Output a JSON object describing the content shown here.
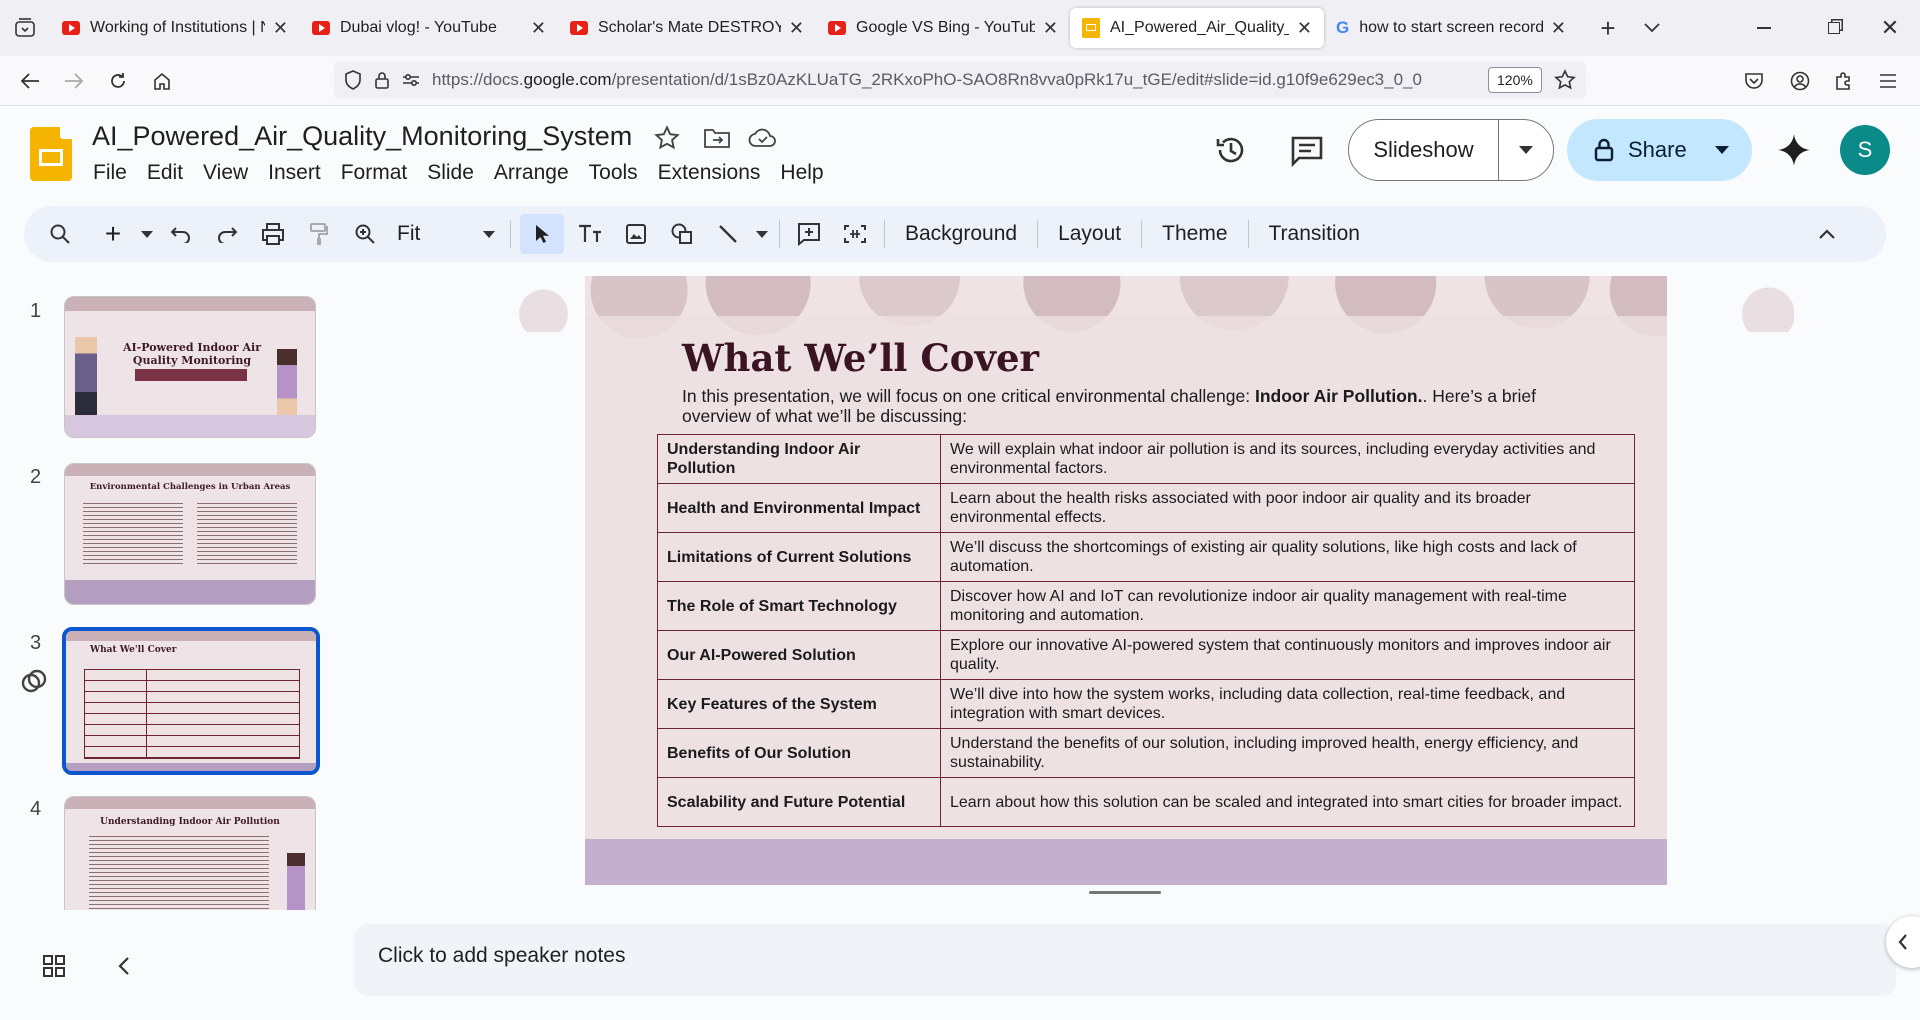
{
  "browser": {
    "tabs": [
      {
        "title": "Working of Institutions | Ne",
        "icon": "youtube-icon"
      },
      {
        "title": "Dubai vlog! - YouTube",
        "icon": "youtube-icon"
      },
      {
        "title": "Scholar's Mate DESTROYED",
        "icon": "youtube-icon"
      },
      {
        "title": "Google VS Bing - YouTube",
        "icon": "youtube-icon"
      },
      {
        "title": "AI_Powered_Air_Quality_Mo",
        "icon": "slides-icon"
      },
      {
        "title": "how to start screen recordin",
        "icon": "google-icon"
      }
    ],
    "url_prefix": "https://docs.",
    "url_domain": "google.com",
    "url_rest": "/presentation/d/1sBz0AzKLUaTG_2RKxoPhO-SAO8Rn8vva0pRk17u_tGE/edit#slide=id.g10f9e629ec3_0_0",
    "zoom": "120%"
  },
  "doc": {
    "title": "AI_Powered_Air_Quality_Monitoring_System",
    "menus": [
      "File",
      "Edit",
      "View",
      "Insert",
      "Format",
      "Slide",
      "Arrange",
      "Tools",
      "Extensions",
      "Help"
    ],
    "slideshow_label": "Slideshow",
    "share_label": "Share",
    "avatar_initial": "S"
  },
  "toolbar": {
    "zoom_label": "Fit",
    "background_label": "Background",
    "layout_label": "Layout",
    "theme_label": "Theme",
    "transition_label": "Transition"
  },
  "filmstrip": {
    "numbers": [
      "1",
      "2",
      "3",
      "4"
    ],
    "t1_title": "AI-Powered Indoor Air Quality Monitoring System",
    "t2_title": "Environmental Challenges in Urban Areas",
    "t3_title": "What We'll Cover",
    "t4_title": "Understanding Indoor Air Pollution"
  },
  "slide": {
    "title": "What We’ll Cover",
    "intro_before": "In this presentation, we will focus on one critical environmental challenge: ",
    "intro_bold": "Indoor Air Pollution.",
    "intro_after": ". Here’s a brief overview of what we’ll be discussing:",
    "rows": [
      {
        "topic": "Understanding Indoor Air Pollution",
        "desc": "We will explain what indoor air pollution is and its sources, including everyday activities and environmental factors."
      },
      {
        "topic": "Health and Environmental Impact",
        "desc": "Learn about the health risks associated with poor indoor air quality and its broader environmental effects."
      },
      {
        "topic": "Limitations of Current Solutions",
        "desc": "We’ll discuss the shortcomings of existing air quality solutions, like high costs and lack of automation."
      },
      {
        "topic": "The Role of Smart Technology",
        "desc": "Discover how AI and IoT can revolutionize indoor air quality management with real-time monitoring and automation."
      },
      {
        "topic": "Our AI-Powered Solution",
        "desc": "Explore our innovative AI-powered system that continuously monitors and improves indoor air quality."
      },
      {
        "topic": "Key Features of the System",
        "desc": "We’ll dive into how the system works, including data collection, real-time feedback, and integration with smart devices."
      },
      {
        "topic": "Benefits of Our Solution",
        "desc": "Understand the benefits of our solution, including improved health, energy efficiency, and sustainability."
      },
      {
        "topic": "Scalability and Future Potential",
        "desc": "Learn about how this solution can be scaled and integrated into smart cities for broader impact."
      }
    ]
  },
  "notes": {
    "placeholder": "Click to add speaker notes"
  }
}
